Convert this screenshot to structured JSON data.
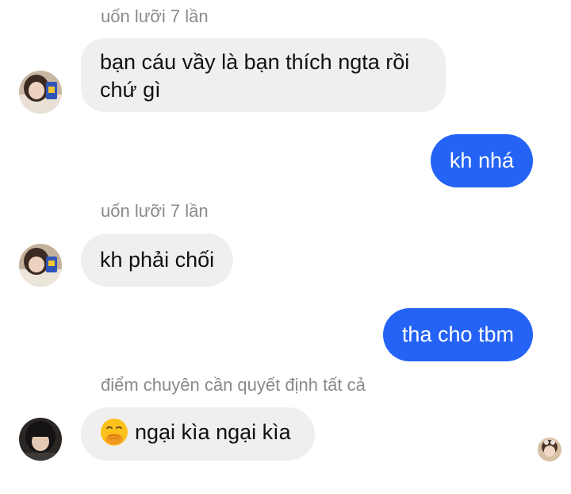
{
  "colors": {
    "incoming_bubble": "#efefef",
    "outgoing_bubble": "#2463f5",
    "sender_name": "#8a8a8e"
  },
  "messages": [
    {
      "sender": "uốn lưỡi 7 lần",
      "text_line1": "bạn cáu vầy là bạn thích ngta rồi",
      "text_line2": "chứ gì"
    },
    {
      "text": "kh nhá"
    },
    {
      "sender": "uốn lưỡi 7 lần",
      "text": "kh phải chối"
    },
    {
      "text": "tha cho tbm"
    },
    {
      "sender": "điểm chuyên cần quyết định tất cả",
      "emoji_icon": "face-with-hand-over-mouth-icon",
      "text": "ngại kìa ngại kìa"
    }
  ]
}
